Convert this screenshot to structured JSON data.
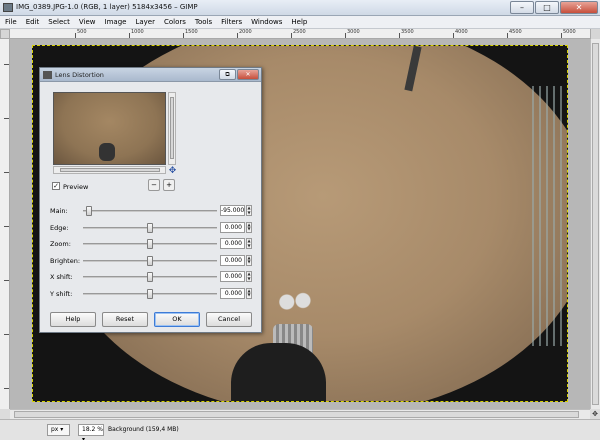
{
  "window": {
    "title": "IMG_0389.JPG-1.0 (RGB, 1 layer) 5184x3456 – GIMP",
    "minimize": "–",
    "maximize": "□",
    "close": "✕"
  },
  "menu": [
    "File",
    "Edit",
    "Select",
    "View",
    "Image",
    "Layer",
    "Colors",
    "Tools",
    "Filters",
    "Windows",
    "Help"
  ],
  "ruler": {
    "labels": [
      "500",
      "1000",
      "1500",
      "2000",
      "2500",
      "3000",
      "3500",
      "4000",
      "4500",
      "5000"
    ]
  },
  "dialog": {
    "title": "Lens Distortion",
    "btn_restore": "⧉",
    "btn_close": "✕",
    "preview_label": "Preview",
    "preview_checked": "✓",
    "zoom_out": "−",
    "zoom_in": "+",
    "params": [
      {
        "label": "Main:",
        "value": "-95.000",
        "level": 0.02
      },
      {
        "label": "Edge:",
        "value": "0.000",
        "level": 0.5
      },
      {
        "label": "Zoom:",
        "value": "0.000",
        "level": 0.5
      },
      {
        "label": "Brighten:",
        "value": "0.000",
        "level": 0.5
      },
      {
        "label": "X shift:",
        "value": "0.000",
        "level": 0.5
      },
      {
        "label": "Y shift:",
        "value": "0.000",
        "level": 0.5
      }
    ],
    "buttons": {
      "help": "Help",
      "reset": "Reset",
      "ok": "OK",
      "cancel": "Cancel"
    }
  },
  "status": {
    "unit": "px ▾",
    "zoom": "18.2 % ▾",
    "text": "Background (159,4 MB)"
  },
  "icons": {
    "move": "move-icon",
    "navigate": "navigate-icon"
  }
}
